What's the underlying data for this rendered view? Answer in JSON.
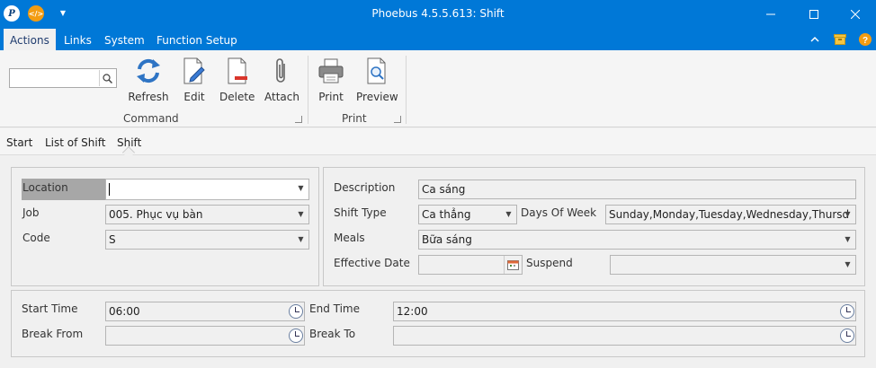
{
  "window": {
    "title": "Phoebus 4.5.5.613: Shift",
    "app_icon": "phoebus-logo-icon",
    "quick_access_icon": "code-icon",
    "controls": [
      "minimize-icon",
      "maximize-icon",
      "close-icon"
    ],
    "accent_color": "#0078d7"
  },
  "menu": {
    "items": [
      "Actions",
      "Links",
      "System",
      "Function Setup"
    ],
    "active": "Actions"
  },
  "ribbon": {
    "search_value": "",
    "search_placeholder": "",
    "buttons": {
      "refresh": "Refresh",
      "edit": "Edit",
      "delete": "Delete",
      "attach": "Attach",
      "print": "Print",
      "preview": "Preview"
    },
    "groups": {
      "command": "Command",
      "print": "Print"
    }
  },
  "breadcrumb": [
    "Start",
    "List of Shift",
    "Shift"
  ],
  "form": {
    "location": {
      "label": "Location",
      "value": ""
    },
    "job": {
      "label": "Job",
      "value": "005. Phục vụ bàn"
    },
    "code": {
      "label": "Code",
      "value": "S"
    },
    "description": {
      "label": "Description",
      "value": "Ca sáng"
    },
    "shift_type": {
      "label": "Shift Type",
      "value": "Ca thẳng"
    },
    "days_of_week": {
      "label": "Days Of Week",
      "value": "Sunday,Monday,Tuesday,Wednesday,Thursd"
    },
    "meals": {
      "label": "Meals",
      "value": "Bữa sáng"
    },
    "effective_date": {
      "label": "Effective Date",
      "value": ""
    },
    "suspend": {
      "label": "Suspend",
      "value": ""
    },
    "start_time": {
      "label": "Start Time",
      "value": "06:00"
    },
    "end_time": {
      "label": "End Time",
      "value": "12:00"
    },
    "break_from": {
      "label": "Break From",
      "value": ""
    },
    "break_to": {
      "label": "Break To",
      "value": ""
    }
  }
}
